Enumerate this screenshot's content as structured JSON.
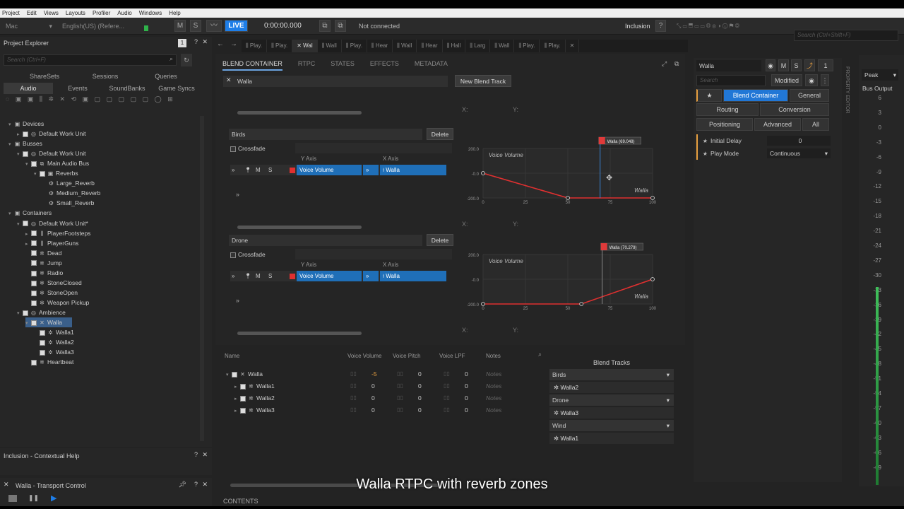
{
  "menu": [
    "Project",
    "Edit",
    "Views",
    "Layouts",
    "Profiler",
    "Audio",
    "Windows",
    "Help"
  ],
  "toolbar": {
    "platform": "Mac",
    "language": "English(US) (Refere...",
    "m": "M",
    "s": "S",
    "live": "LIVE",
    "time": "0:00:00.000",
    "connection": "Not connected",
    "inclusion": "Inclusion",
    "help": "?",
    "search_placeholder": "Search (Ctrl+Shift+F)"
  },
  "explorer": {
    "title": "Project Explorer",
    "search_placeholder": "Search (Ctrl+F)",
    "tabs1": [
      "ShareSets",
      "Sessions",
      "Queries"
    ],
    "tabs2": [
      "Audio",
      "Events",
      "SoundBanks",
      "Game Syncs"
    ],
    "tree": [
      {
        "label": "Devices",
        "level": 0,
        "arrow": "▾",
        "icon": "▣",
        "cb": false
      },
      {
        "label": "Default Work Unit",
        "level": 1,
        "arrow": "▸",
        "icon": "◎",
        "cb": true
      },
      {
        "label": "Busses",
        "level": 0,
        "arrow": "▾",
        "icon": "▣",
        "cb": false
      },
      {
        "label": "Default Work Unit",
        "level": 1,
        "arrow": "▾",
        "icon": "◎",
        "cb": true
      },
      {
        "label": "Main Audio Bus",
        "level": 2,
        "arrow": "▾",
        "icon": "⧉",
        "cb": true
      },
      {
        "label": "Reverbs",
        "level": 3,
        "arrow": "▾",
        "icon": "▣",
        "cb": true
      },
      {
        "label": "Large_Reverb",
        "level": 4,
        "arrow": "",
        "icon": "⚙",
        "cb": false
      },
      {
        "label": "Medium_Reverb",
        "level": 4,
        "arrow": "",
        "icon": "⚙",
        "cb": false
      },
      {
        "label": "Small_Reverb",
        "level": 4,
        "arrow": "",
        "icon": "⚙",
        "cb": false
      },
      {
        "label": "Containers",
        "level": 0,
        "arrow": "▾",
        "icon": "▣",
        "cb": false
      },
      {
        "label": "Default Work Unit*",
        "level": 1,
        "arrow": "▾",
        "icon": "◎",
        "cb": true
      },
      {
        "label": "PlayerFootsteps",
        "level": 2,
        "arrow": "▸",
        "icon": "⫼",
        "cb": true
      },
      {
        "label": "PlayerGuns",
        "level": 2,
        "arrow": "▸",
        "icon": "⫼",
        "cb": true
      },
      {
        "label": "Dead",
        "level": 2,
        "arrow": "",
        "icon": "✲",
        "cb": true
      },
      {
        "label": "Jump",
        "level": 2,
        "arrow": "",
        "icon": "✲",
        "cb": true
      },
      {
        "label": "Radio",
        "level": 2,
        "arrow": "",
        "icon": "✲",
        "cb": true
      },
      {
        "label": "StoneClosed",
        "level": 2,
        "arrow": "",
        "icon": "✲",
        "cb": true
      },
      {
        "label": "StoneOpen",
        "level": 2,
        "arrow": "",
        "icon": "✲",
        "cb": true
      },
      {
        "label": "Weapon Pickup",
        "level": 2,
        "arrow": "",
        "icon": "✲",
        "cb": true
      },
      {
        "label": "Ambience",
        "level": 1,
        "arrow": "▾",
        "icon": "◎",
        "cb": true
      },
      {
        "label": "Walla",
        "level": 2,
        "arrow": "▾",
        "icon": "✕",
        "cb": true,
        "selected": true
      },
      {
        "label": "Walla1",
        "level": 3,
        "arrow": "",
        "icon": "✲",
        "cb": true
      },
      {
        "label": "Walla2",
        "level": 3,
        "arrow": "",
        "icon": "✲",
        "cb": true
      },
      {
        "label": "Walla3",
        "level": 3,
        "arrow": "",
        "icon": "✲",
        "cb": true
      },
      {
        "label": "Heartbeat",
        "level": 2,
        "arrow": "",
        "icon": "✲",
        "cb": true
      }
    ]
  },
  "help_panel": {
    "title": "Inclusion - Contextual Help"
  },
  "transport": {
    "title": "Walla - Transport Control"
  },
  "doctabs": [
    "Play.",
    "Play.",
    "Wal",
    "Wall",
    "Play.",
    "Hear",
    "Wall",
    "Hear",
    "Hall",
    "Larg",
    "Wall",
    "Play.",
    "Play."
  ],
  "editor": {
    "subtabs": [
      "BLEND CONTAINER",
      "RTPC",
      "STATES",
      "EFFECTS",
      "METADATA"
    ],
    "object": "Walla",
    "new_blend": "New Blend Track",
    "x_label": "X:",
    "y_label": "Y:",
    "tracks": [
      {
        "name": "Birds",
        "delete": "Delete",
        "crossfade": "Crossfade",
        "y_axis": "Y Axis",
        "x_axis": "X Axis",
        "param": "Voice Volume",
        "game_param": "Walla",
        "marker": "Walla (69.048)",
        "graph_label": "Voice Volume",
        "curve_label": "Walla",
        "yticks": [
          "200.0",
          "-0.0",
          "-200.0"
        ],
        "xticks": [
          "0",
          "25",
          "50",
          "75",
          "100"
        ]
      },
      {
        "name": "Drone",
        "delete": "Delete",
        "crossfade": "Crossfade",
        "y_axis": "Y Axis",
        "x_axis": "X Axis",
        "param": "Voice Volume",
        "game_param": "Walla",
        "marker": "Walla (70.279)",
        "graph_label": "Voice Volume",
        "curve_label": "Walla",
        "yticks": [
          "200.0",
          "-0.0",
          "-200.0"
        ],
        "xticks": [
          "0",
          "25",
          "50",
          "75",
          "100"
        ]
      }
    ],
    "msb": {
      "m": "M",
      "s": "S",
      "arrows": "»"
    }
  },
  "contents": {
    "columns": [
      "Name",
      "Voice Volume",
      "Voice Pitch",
      "Voice LPF",
      "Notes"
    ],
    "rows": [
      {
        "name": "Walla",
        "vol": "-5",
        "pitch": "0",
        "lpf": "0",
        "notes": "Notes"
      },
      {
        "name": "Walla1",
        "vol": "0",
        "pitch": "0",
        "lpf": "0",
        "notes": "Notes"
      },
      {
        "name": "Walla2",
        "vol": "0",
        "pitch": "0",
        "lpf": "0",
        "notes": "Notes"
      },
      {
        "name": "Walla3",
        "vol": "0",
        "pitch": "0",
        "lpf": "0",
        "notes": "Notes"
      }
    ],
    "blend_header": "Blend Tracks",
    "blend_groups": [
      {
        "name": "Birds",
        "item": "Walla2"
      },
      {
        "name": "Drone",
        "item": "Walla3"
      },
      {
        "name": "Wind",
        "item": "Walla1"
      }
    ],
    "footer": "CONTENTS"
  },
  "property": {
    "name": "Walla",
    "search_placeholder": "Search",
    "modified": "Modified",
    "m": "M",
    "s": "S",
    "count": "1",
    "tabs_row1": [
      "Blend Container",
      "General"
    ],
    "tabs_row2": [
      "Routing",
      "Conversion"
    ],
    "tabs_row3": [
      "Positioning",
      "Advanced",
      "All"
    ],
    "props": [
      {
        "label": "Initial Delay",
        "value": "0"
      },
      {
        "label": "Play Mode",
        "value": "Continuous"
      }
    ],
    "vertical_title": "PROPERTY EDITOR"
  },
  "meter": {
    "mode": "Peak",
    "title": "Bus Output",
    "scale": [
      "6",
      "3",
      "0",
      "-3",
      "-6",
      "-9",
      "-12",
      "-15",
      "-18",
      "-21",
      "-24",
      "-27",
      "-30",
      "-33",
      "-36",
      "-39",
      "-42",
      "-45",
      "-48",
      "-51",
      "-54",
      "-57",
      "-60",
      "-63",
      "-66",
      "-69"
    ]
  },
  "caption": "Walla RTPC with reverb zones",
  "colors": {
    "accent": "#1e7ee8",
    "curve": "#e03030",
    "marker": "#e03a3a"
  }
}
